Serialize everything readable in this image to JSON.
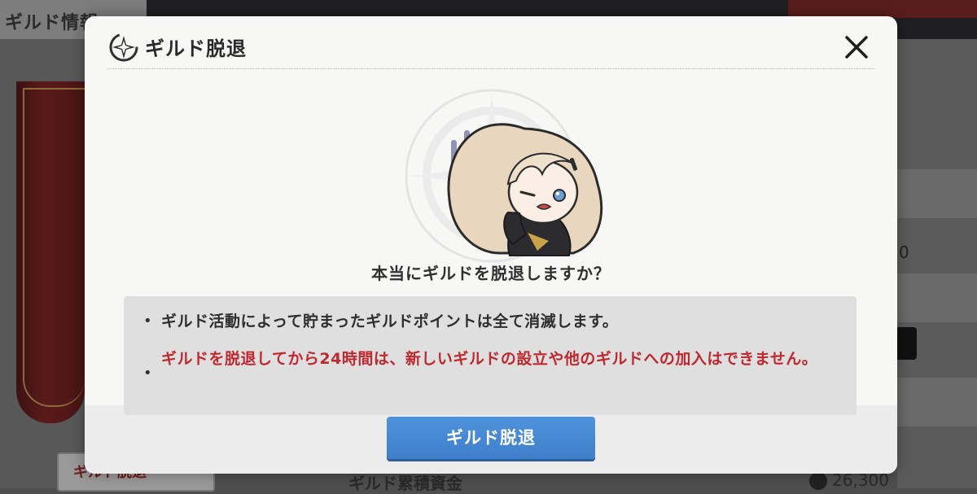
{
  "background": {
    "tab_label": "ギルド情報",
    "bottom_left_button_label": "ギルド脱退",
    "bottom_mid_label": "ギルド累積資金",
    "bottom_right_value": "26,300",
    "right_row_value": "0"
  },
  "modal": {
    "icon": "compass-star-icon",
    "title": "ギルド脱退",
    "close_icon": "close-icon",
    "question": "本当にギルドを脱退しますか？",
    "notices": [
      {
        "bullet": "•",
        "text": "ギルド活動によって貯まったギルドポイントは全て消滅します。",
        "color": "#2e2e2e"
      },
      {
        "bullet": "•",
        "text": "ギルドを脱退してから24時間は、新しいギルドの設立や他のギルドへの加入はできません。",
        "color": "#c0282f"
      }
    ],
    "confirm_button_label": "ギルド脱退"
  },
  "colors": {
    "accent_blue": "#3f7fca",
    "warning_red": "#c0282f",
    "modal_bg": "#f7f7f6"
  }
}
